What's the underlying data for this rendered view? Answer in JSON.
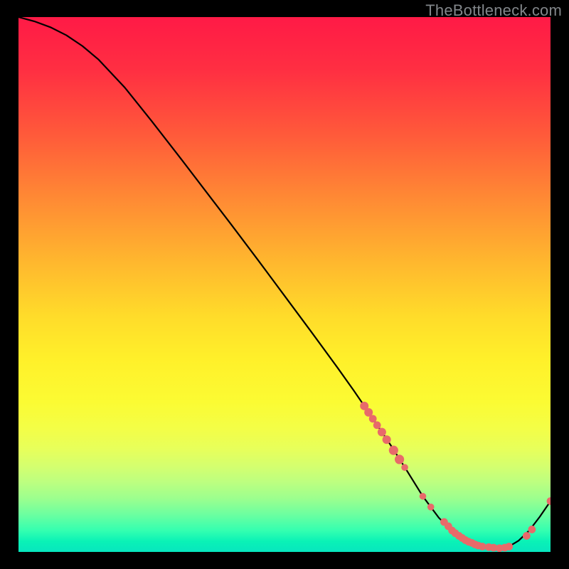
{
  "attribution": "TheBottleneck.com",
  "colors": {
    "bg": "#000000",
    "curve": "#000000",
    "dot": "#e86a6a"
  },
  "chart_data": {
    "type": "line",
    "title": "",
    "xlabel": "",
    "ylabel": "",
    "xlim": [
      0,
      100
    ],
    "ylim": [
      0,
      100
    ],
    "grid": false,
    "curve": {
      "x": [
        0,
        3,
        6,
        9,
        12,
        15,
        20,
        25,
        30,
        35,
        40,
        45,
        50,
        55,
        60,
        63,
        65,
        67.5,
        70,
        73,
        76,
        79,
        82,
        85,
        88,
        90,
        92,
        94,
        96,
        98,
        100
      ],
      "y": [
        100,
        99.2,
        98.1,
        96.6,
        94.6,
        92.1,
        86.8,
        80.6,
        74.2,
        67.7,
        61.2,
        54.6,
        47.9,
        41.2,
        34.4,
        30.2,
        27.3,
        23.6,
        19.9,
        15.2,
        10.4,
        6.4,
        3.4,
        1.7,
        0.9,
        0.7,
        0.9,
        2.1,
        4.0,
        6.6,
        9.5
      ]
    },
    "markers": [
      {
        "x": 65.0,
        "y": 27.3,
        "r": 1.0
      },
      {
        "x": 65.8,
        "y": 26.1,
        "r": 1.0
      },
      {
        "x": 66.6,
        "y": 24.9,
        "r": 0.9
      },
      {
        "x": 67.4,
        "y": 23.7,
        "r": 0.9
      },
      {
        "x": 68.3,
        "y": 22.4,
        "r": 1.0
      },
      {
        "x": 69.2,
        "y": 21.0,
        "r": 1.0
      },
      {
        "x": 70.5,
        "y": 19.0,
        "r": 1.1
      },
      {
        "x": 71.6,
        "y": 17.3,
        "r": 1.1
      },
      {
        "x": 72.6,
        "y": 15.8,
        "r": 0.8
      },
      {
        "x": 76.0,
        "y": 10.4,
        "r": 0.8
      },
      {
        "x": 77.5,
        "y": 8.4,
        "r": 0.8
      },
      {
        "x": 80.0,
        "y": 5.6,
        "r": 0.9
      },
      {
        "x": 80.8,
        "y": 4.8,
        "r": 0.9
      },
      {
        "x": 81.5,
        "y": 4.0,
        "r": 0.9
      },
      {
        "x": 82.1,
        "y": 3.5,
        "r": 0.9
      },
      {
        "x": 82.8,
        "y": 3.0,
        "r": 0.9
      },
      {
        "x": 83.4,
        "y": 2.6,
        "r": 0.9
      },
      {
        "x": 84.0,
        "y": 2.2,
        "r": 0.9
      },
      {
        "x": 84.6,
        "y": 1.9,
        "r": 0.9
      },
      {
        "x": 85.2,
        "y": 1.7,
        "r": 0.9
      },
      {
        "x": 85.8,
        "y": 1.4,
        "r": 0.9
      },
      {
        "x": 86.4,
        "y": 1.2,
        "r": 0.9
      },
      {
        "x": 87.2,
        "y": 1.0,
        "r": 0.9
      },
      {
        "x": 88.4,
        "y": 0.9,
        "r": 0.9
      },
      {
        "x": 89.3,
        "y": 0.8,
        "r": 0.9
      },
      {
        "x": 90.4,
        "y": 0.7,
        "r": 0.9
      },
      {
        "x": 91.4,
        "y": 0.8,
        "r": 0.9
      },
      {
        "x": 92.2,
        "y": 1.0,
        "r": 0.9
      },
      {
        "x": 95.5,
        "y": 3.0,
        "r": 0.9
      },
      {
        "x": 96.5,
        "y": 4.2,
        "r": 0.9
      },
      {
        "x": 100.0,
        "y": 9.5,
        "r": 0.9
      }
    ]
  }
}
